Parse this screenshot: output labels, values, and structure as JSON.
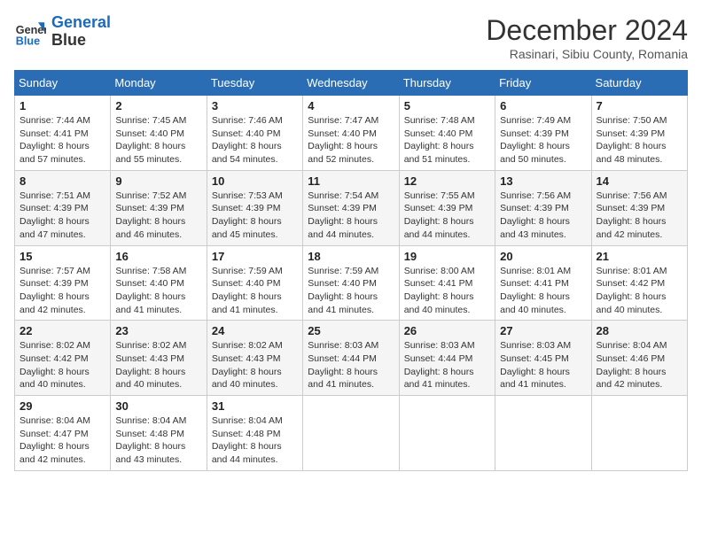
{
  "header": {
    "logo_line1": "General",
    "logo_line2": "Blue",
    "month": "December 2024",
    "location": "Rasinari, Sibiu County, Romania"
  },
  "weekdays": [
    "Sunday",
    "Monday",
    "Tuesday",
    "Wednesday",
    "Thursday",
    "Friday",
    "Saturday"
  ],
  "weeks": [
    [
      {
        "day": "1",
        "sunrise": "Sunrise: 7:44 AM",
        "sunset": "Sunset: 4:41 PM",
        "daylight": "Daylight: 8 hours and 57 minutes."
      },
      {
        "day": "2",
        "sunrise": "Sunrise: 7:45 AM",
        "sunset": "Sunset: 4:40 PM",
        "daylight": "Daylight: 8 hours and 55 minutes."
      },
      {
        "day": "3",
        "sunrise": "Sunrise: 7:46 AM",
        "sunset": "Sunset: 4:40 PM",
        "daylight": "Daylight: 8 hours and 54 minutes."
      },
      {
        "day": "4",
        "sunrise": "Sunrise: 7:47 AM",
        "sunset": "Sunset: 4:40 PM",
        "daylight": "Daylight: 8 hours and 52 minutes."
      },
      {
        "day": "5",
        "sunrise": "Sunrise: 7:48 AM",
        "sunset": "Sunset: 4:40 PM",
        "daylight": "Daylight: 8 hours and 51 minutes."
      },
      {
        "day": "6",
        "sunrise": "Sunrise: 7:49 AM",
        "sunset": "Sunset: 4:39 PM",
        "daylight": "Daylight: 8 hours and 50 minutes."
      },
      {
        "day": "7",
        "sunrise": "Sunrise: 7:50 AM",
        "sunset": "Sunset: 4:39 PM",
        "daylight": "Daylight: 8 hours and 48 minutes."
      }
    ],
    [
      {
        "day": "8",
        "sunrise": "Sunrise: 7:51 AM",
        "sunset": "Sunset: 4:39 PM",
        "daylight": "Daylight: 8 hours and 47 minutes."
      },
      {
        "day": "9",
        "sunrise": "Sunrise: 7:52 AM",
        "sunset": "Sunset: 4:39 PM",
        "daylight": "Daylight: 8 hours and 46 minutes."
      },
      {
        "day": "10",
        "sunrise": "Sunrise: 7:53 AM",
        "sunset": "Sunset: 4:39 PM",
        "daylight": "Daylight: 8 hours and 45 minutes."
      },
      {
        "day": "11",
        "sunrise": "Sunrise: 7:54 AM",
        "sunset": "Sunset: 4:39 PM",
        "daylight": "Daylight: 8 hours and 44 minutes."
      },
      {
        "day": "12",
        "sunrise": "Sunrise: 7:55 AM",
        "sunset": "Sunset: 4:39 PM",
        "daylight": "Daylight: 8 hours and 44 minutes."
      },
      {
        "day": "13",
        "sunrise": "Sunrise: 7:56 AM",
        "sunset": "Sunset: 4:39 PM",
        "daylight": "Daylight: 8 hours and 43 minutes."
      },
      {
        "day": "14",
        "sunrise": "Sunrise: 7:56 AM",
        "sunset": "Sunset: 4:39 PM",
        "daylight": "Daylight: 8 hours and 42 minutes."
      }
    ],
    [
      {
        "day": "15",
        "sunrise": "Sunrise: 7:57 AM",
        "sunset": "Sunset: 4:39 PM",
        "daylight": "Daylight: 8 hours and 42 minutes."
      },
      {
        "day": "16",
        "sunrise": "Sunrise: 7:58 AM",
        "sunset": "Sunset: 4:40 PM",
        "daylight": "Daylight: 8 hours and 41 minutes."
      },
      {
        "day": "17",
        "sunrise": "Sunrise: 7:59 AM",
        "sunset": "Sunset: 4:40 PM",
        "daylight": "Daylight: 8 hours and 41 minutes."
      },
      {
        "day": "18",
        "sunrise": "Sunrise: 7:59 AM",
        "sunset": "Sunset: 4:40 PM",
        "daylight": "Daylight: 8 hours and 41 minutes."
      },
      {
        "day": "19",
        "sunrise": "Sunrise: 8:00 AM",
        "sunset": "Sunset: 4:41 PM",
        "daylight": "Daylight: 8 hours and 40 minutes."
      },
      {
        "day": "20",
        "sunrise": "Sunrise: 8:01 AM",
        "sunset": "Sunset: 4:41 PM",
        "daylight": "Daylight: 8 hours and 40 minutes."
      },
      {
        "day": "21",
        "sunrise": "Sunrise: 8:01 AM",
        "sunset": "Sunset: 4:42 PM",
        "daylight": "Daylight: 8 hours and 40 minutes."
      }
    ],
    [
      {
        "day": "22",
        "sunrise": "Sunrise: 8:02 AM",
        "sunset": "Sunset: 4:42 PM",
        "daylight": "Daylight: 8 hours and 40 minutes."
      },
      {
        "day": "23",
        "sunrise": "Sunrise: 8:02 AM",
        "sunset": "Sunset: 4:43 PM",
        "daylight": "Daylight: 8 hours and 40 minutes."
      },
      {
        "day": "24",
        "sunrise": "Sunrise: 8:02 AM",
        "sunset": "Sunset: 4:43 PM",
        "daylight": "Daylight: 8 hours and 40 minutes."
      },
      {
        "day": "25",
        "sunrise": "Sunrise: 8:03 AM",
        "sunset": "Sunset: 4:44 PM",
        "daylight": "Daylight: 8 hours and 41 minutes."
      },
      {
        "day": "26",
        "sunrise": "Sunrise: 8:03 AM",
        "sunset": "Sunset: 4:44 PM",
        "daylight": "Daylight: 8 hours and 41 minutes."
      },
      {
        "day": "27",
        "sunrise": "Sunrise: 8:03 AM",
        "sunset": "Sunset: 4:45 PM",
        "daylight": "Daylight: 8 hours and 41 minutes."
      },
      {
        "day": "28",
        "sunrise": "Sunrise: 8:04 AM",
        "sunset": "Sunset: 4:46 PM",
        "daylight": "Daylight: 8 hours and 42 minutes."
      }
    ],
    [
      {
        "day": "29",
        "sunrise": "Sunrise: 8:04 AM",
        "sunset": "Sunset: 4:47 PM",
        "daylight": "Daylight: 8 hours and 42 minutes."
      },
      {
        "day": "30",
        "sunrise": "Sunrise: 8:04 AM",
        "sunset": "Sunset: 4:48 PM",
        "daylight": "Daylight: 8 hours and 43 minutes."
      },
      {
        "day": "31",
        "sunrise": "Sunrise: 8:04 AM",
        "sunset": "Sunset: 4:48 PM",
        "daylight": "Daylight: 8 hours and 44 minutes."
      },
      null,
      null,
      null,
      null
    ]
  ]
}
